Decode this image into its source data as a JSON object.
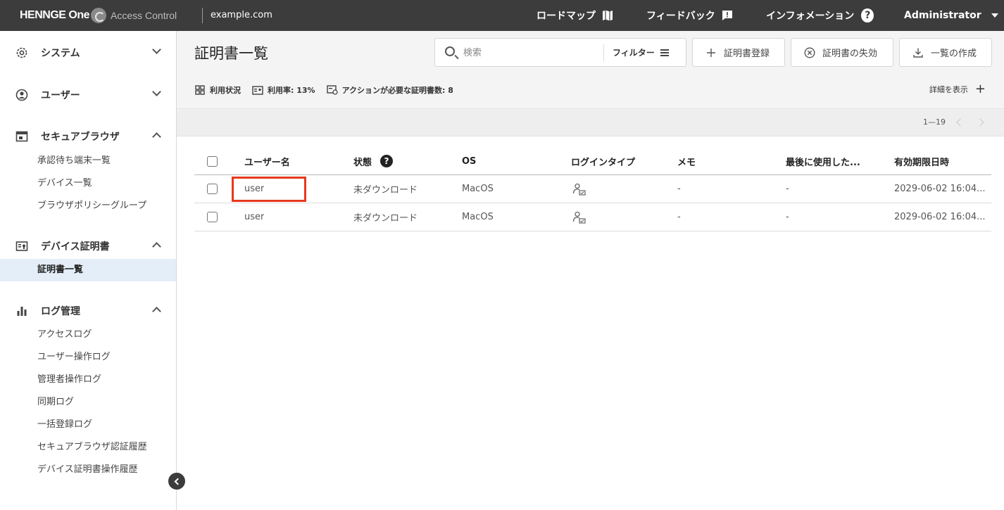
{
  "topbar": {
    "logo_text": "HENNGE One",
    "product": "Access Control",
    "domain": "example.com",
    "links": [
      {
        "label": "ロードマップ",
        "icon": "map-icon"
      },
      {
        "label": "フィードバック",
        "icon": "feedback-icon"
      },
      {
        "label": "インフォメーション",
        "icon": "help-icon"
      }
    ],
    "user": "Administrator"
  },
  "sidebar": {
    "sections": [
      {
        "label": "システム",
        "icon": "gear-icon",
        "expanded": false
      },
      {
        "label": "ユーザー",
        "icon": "user-icon",
        "expanded": false
      },
      {
        "label": "セキュアブラウザ",
        "icon": "browser-icon",
        "expanded": true
      },
      {
        "label": "デバイス証明書",
        "icon": "certificate-icon",
        "expanded": true
      },
      {
        "label": "ログ管理",
        "icon": "chart-icon",
        "expanded": true
      }
    ],
    "secure_browser_items": [
      "承認待ち端末一覧",
      "デバイス一覧",
      "ブラウザポリシーグループ"
    ],
    "certificate_items": [
      "証明書一覧"
    ],
    "log_items": [
      "アクセスログ",
      "ユーザー操作ログ",
      "管理者操作ログ",
      "同期ログ",
      "一括登録ログ",
      "セキュアブラウザ認証履歴",
      "デバイス証明書操作履歴"
    ]
  },
  "main": {
    "title": "証明書一覧",
    "search_placeholder": "検索",
    "filter_label": "フィルター",
    "buttons": {
      "register": "証明書登録",
      "revoke": "証明書の失効",
      "export": "一覧の作成"
    },
    "stats": {
      "usage": "利用状況",
      "rate": "利用率: 13%",
      "action_needed": "アクションが必要な証明書数: 8"
    },
    "details_toggle": "詳細を表示",
    "pager": "1—19"
  },
  "table": {
    "columns": [
      "ユーザー名",
      "状態",
      "OS",
      "ログインタイプ",
      "メモ",
      "最後に使用した...",
      "有効期限日時"
    ],
    "rows": [
      {
        "user": "user",
        "status": "未ダウンロード",
        "os": "MacOS",
        "memo": "-",
        "last_used": "-",
        "expires": "2029-06-02 16:04..."
      },
      {
        "user": "user",
        "status": "未ダウンロード",
        "os": "MacOS",
        "memo": "-",
        "last_used": "-",
        "expires": "2029-06-02 16:04..."
      }
    ]
  },
  "colors": {
    "topbar": "#3c3c3c",
    "active_item": "#e3eef9",
    "highlight": "#e8381d"
  }
}
